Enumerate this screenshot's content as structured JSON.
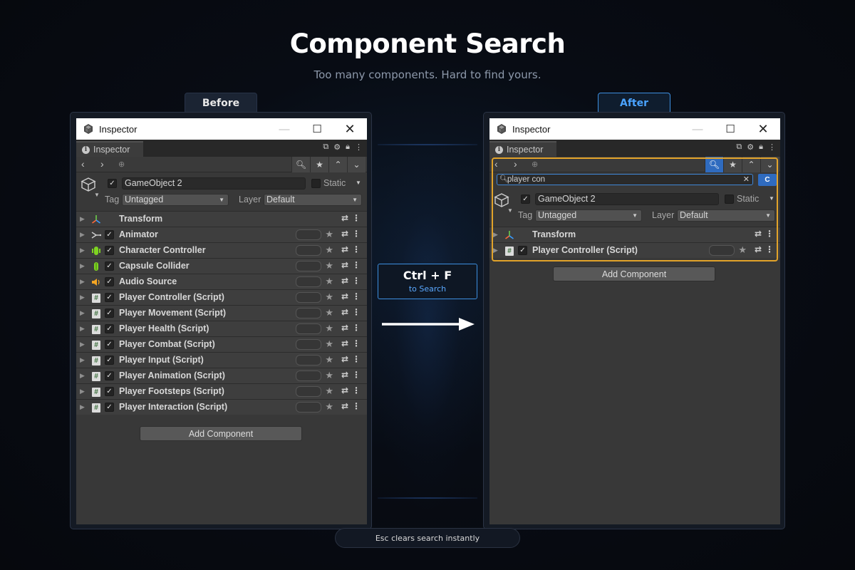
{
  "title": "Component Search",
  "subtitle": "Too many components. Hard to find yours.",
  "labels": {
    "before": "Before",
    "after": "After"
  },
  "shortcut": {
    "keys": "Ctrl + F",
    "caption": "to Search"
  },
  "footer": "Esc clears search instantly",
  "inspector": {
    "window_title": "Inspector",
    "tab_label": "Inspector",
    "gameobject_name": "GameObject 2",
    "static_label": "Static",
    "tag_label": "Tag",
    "tag_value": "Untagged",
    "layer_label": "Layer",
    "layer_value": "Default",
    "add_component": "Add Component"
  },
  "before_components": [
    {
      "name": "Transform",
      "icon": "transform-icon"
    },
    {
      "name": "Animator",
      "icon": "animator-icon"
    },
    {
      "name": "Character Controller",
      "icon": "character-controller-icon"
    },
    {
      "name": "Capsule Collider",
      "icon": "capsule-collider-icon"
    },
    {
      "name": "Audio Source",
      "icon": "audio-source-icon"
    },
    {
      "name": "Player Controller (Script)",
      "icon": "script-icon"
    },
    {
      "name": "Player Movement (Script)",
      "icon": "script-icon"
    },
    {
      "name": "Player Health (Script)",
      "icon": "script-icon"
    },
    {
      "name": "Player Combat (Script)",
      "icon": "script-icon"
    },
    {
      "name": "Player Input (Script)",
      "icon": "script-icon"
    },
    {
      "name": "Player Animation (Script)",
      "icon": "script-icon"
    },
    {
      "name": "Player Footsteps (Script)",
      "icon": "script-icon"
    },
    {
      "name": "Player Interaction (Script)",
      "icon": "script-icon"
    }
  ],
  "after_components": [
    {
      "name": "Transform",
      "icon": "transform-icon"
    },
    {
      "name": "Player Controller (Script)",
      "icon": "script-icon"
    }
  ],
  "search": {
    "query": "player con",
    "case_button": "C"
  },
  "colors": {
    "accent_blue": "#3d8fe0",
    "highlight_orange": "#e2a32a",
    "background": "#080c14"
  }
}
